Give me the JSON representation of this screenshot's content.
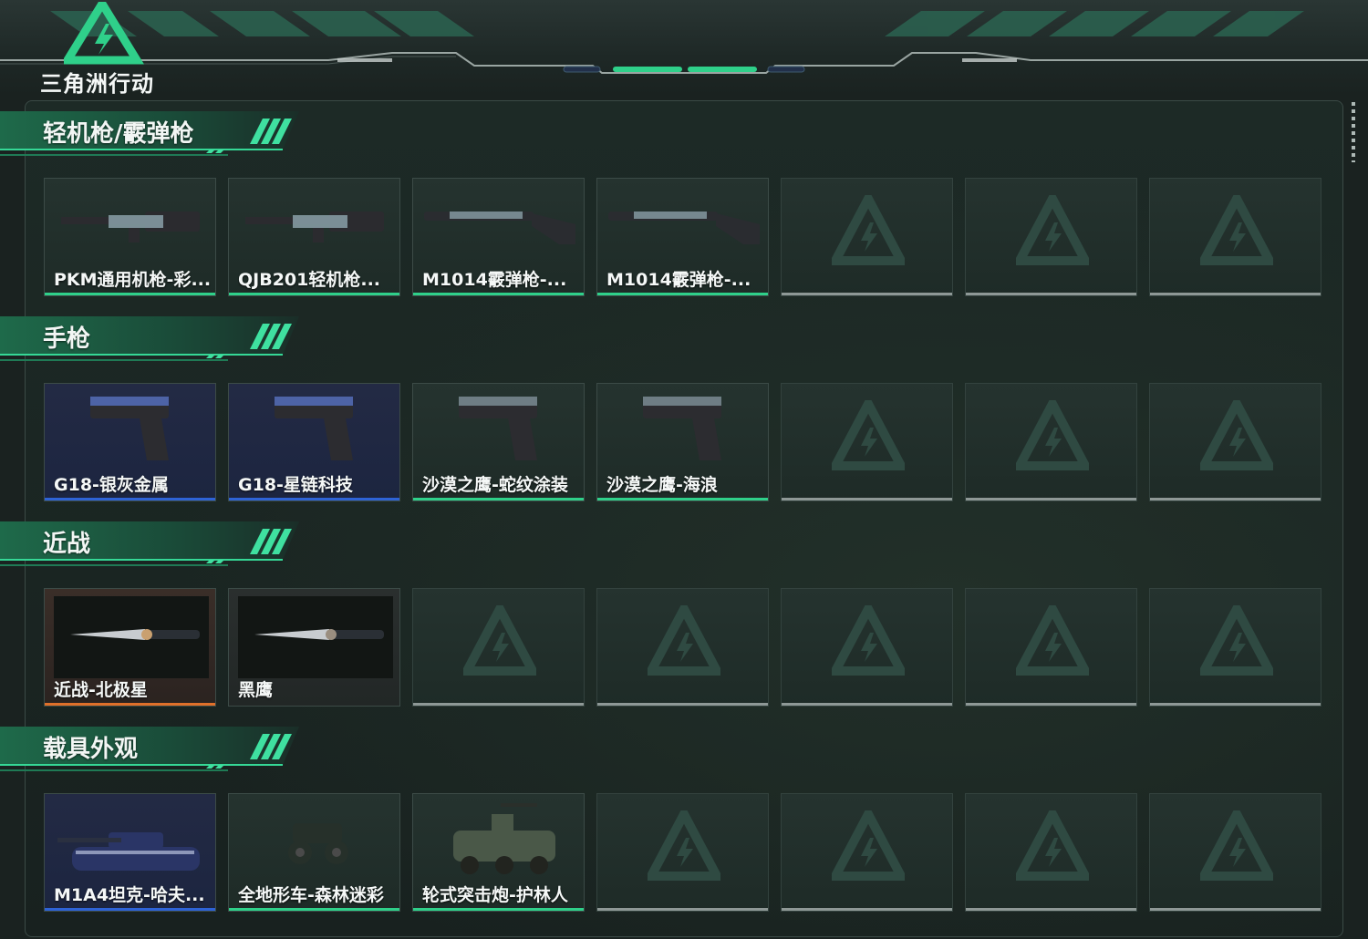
{
  "app": {
    "logo_text": "三角洲行动",
    "accent": "#2fd08a"
  },
  "sections": [
    {
      "title": "轻机枪/霰弹枪",
      "items": [
        {
          "name": "PKM通用机枪-彩...",
          "quality": "green",
          "icon": "lmg-icon"
        },
        {
          "name": "QJB201轻机枪...",
          "quality": "green",
          "icon": "lmg-icon"
        },
        {
          "name": "M1014霰弹枪-...",
          "quality": "green",
          "icon": "shotgun-icon"
        },
        {
          "name": "M1014霰弹枪-...",
          "quality": "green",
          "icon": "shotgun-icon"
        },
        {
          "empty": true
        },
        {
          "empty": true
        },
        {
          "empty": true
        }
      ]
    },
    {
      "title": "手枪",
      "items": [
        {
          "name": "G18-银灰金属",
          "quality": "blue",
          "icon": "pistol-icon"
        },
        {
          "name": "G18-星链科技",
          "quality": "blue",
          "icon": "pistol-icon"
        },
        {
          "name": "沙漠之鹰-蛇纹涂装",
          "quality": "green",
          "icon": "pistol-icon"
        },
        {
          "name": "沙漠之鹰-海浪",
          "quality": "green",
          "icon": "pistol-icon"
        },
        {
          "empty": true
        },
        {
          "empty": true
        },
        {
          "empty": true
        }
      ]
    },
    {
      "title": "近战",
      "items": [
        {
          "name": "近战-北极星",
          "quality": "orange",
          "icon": "knife-icon"
        },
        {
          "name": "黑鹰",
          "quality": "gray",
          "icon": "knife-icon"
        },
        {
          "empty": true
        },
        {
          "empty": true
        },
        {
          "empty": true
        },
        {
          "empty": true
        },
        {
          "empty": true
        }
      ]
    },
    {
      "title": "载具外观",
      "items": [
        {
          "name": "M1A4坦克-哈夫...",
          "quality": "blue",
          "icon": "tank-icon"
        },
        {
          "name": "全地形车-森林迷彩",
          "quality": "green",
          "icon": "atv-icon"
        },
        {
          "name": "轮式突击炮-护林人",
          "quality": "green",
          "icon": "armored-car-icon"
        },
        {
          "empty": true
        },
        {
          "empty": true
        },
        {
          "empty": true
        },
        {
          "empty": true
        }
      ]
    }
  ]
}
